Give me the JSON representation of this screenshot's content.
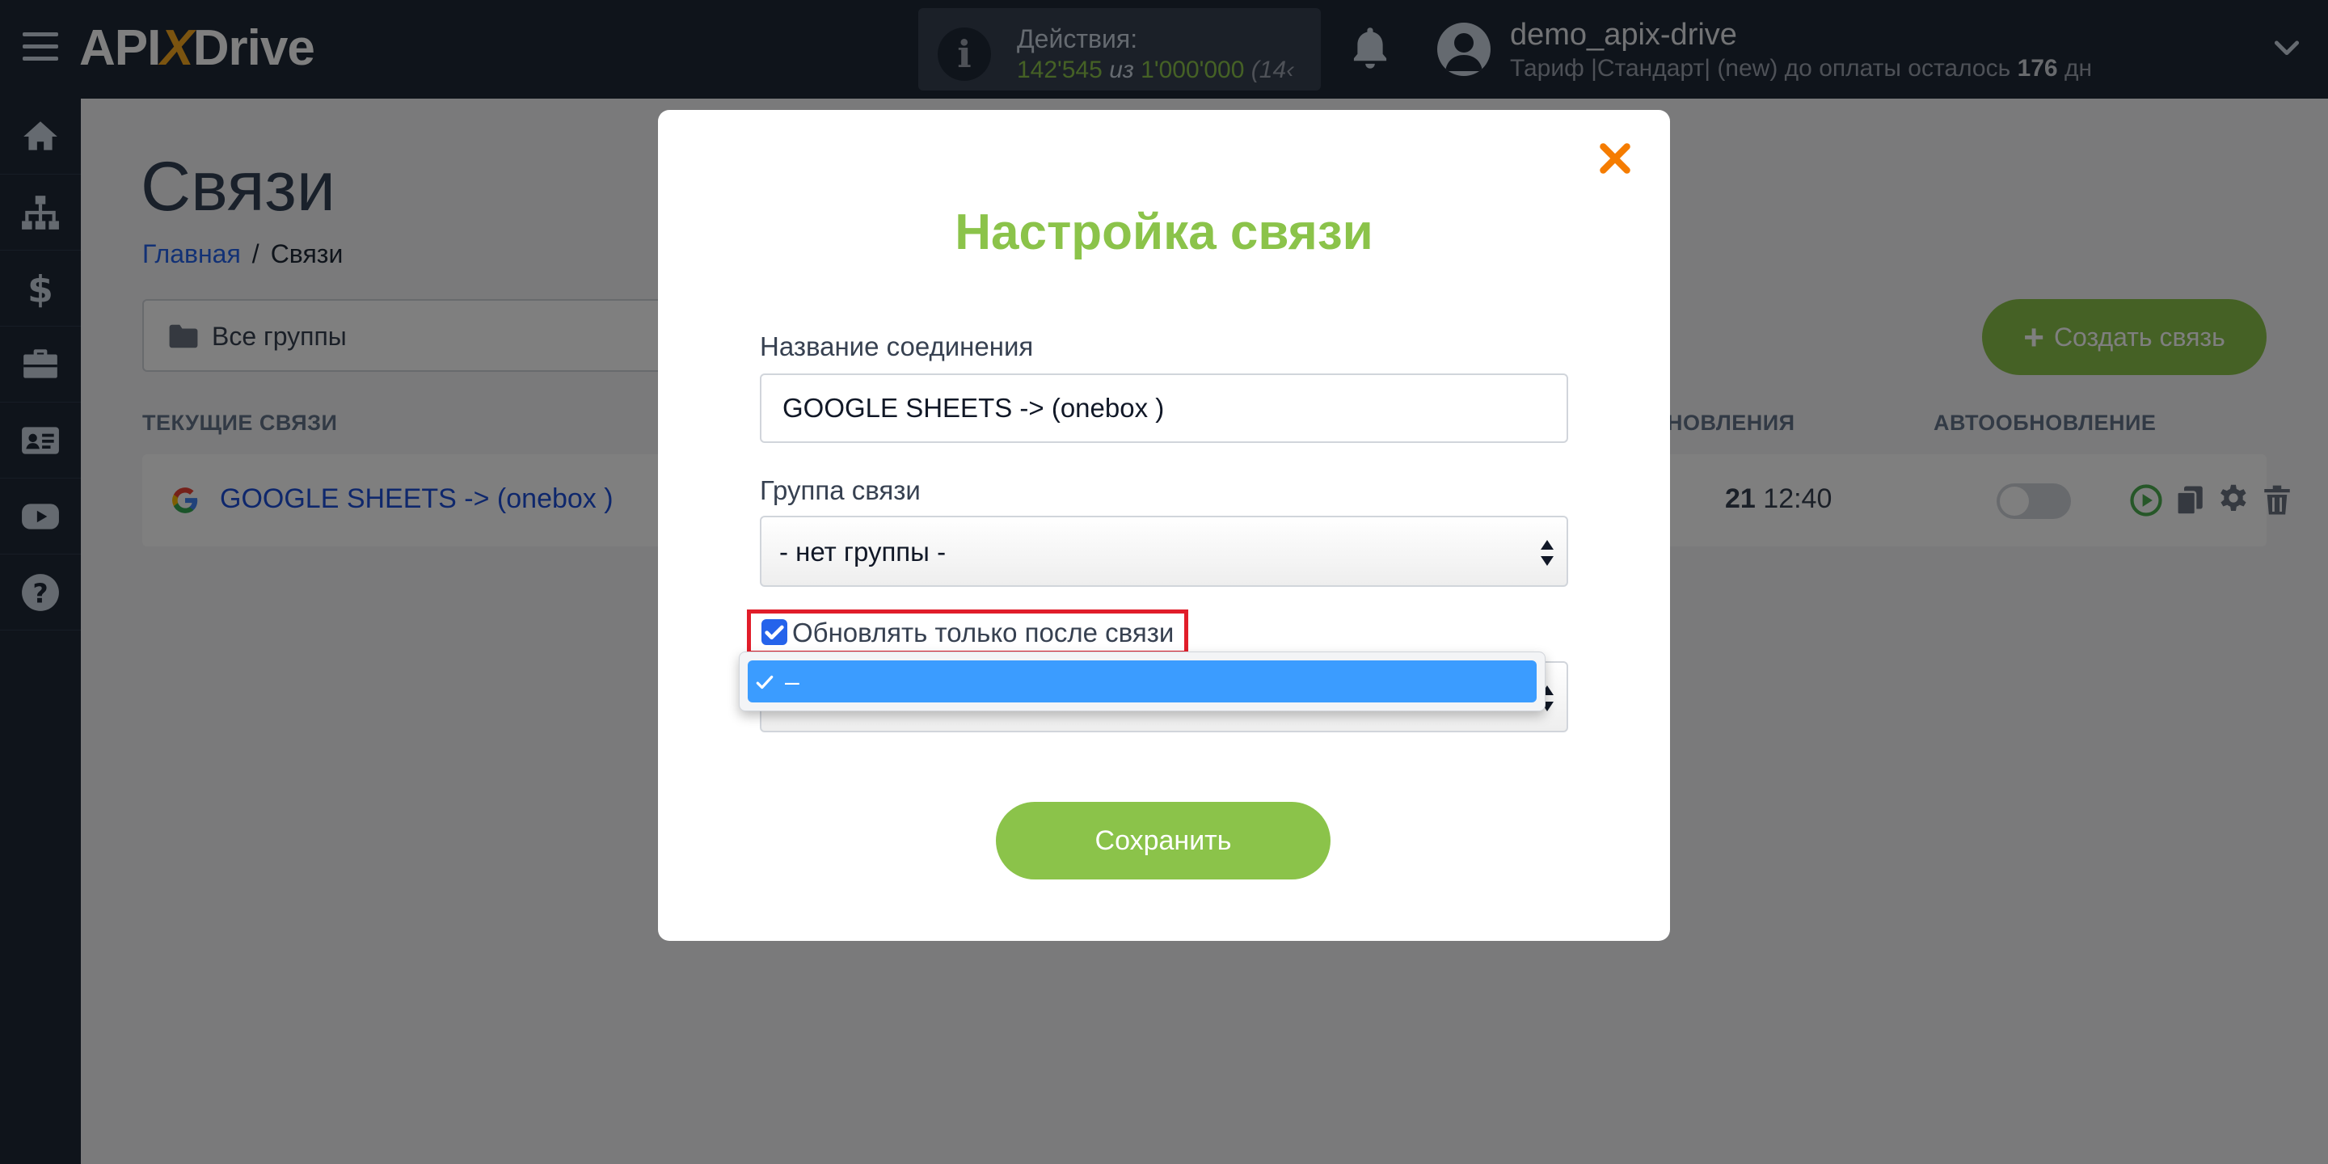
{
  "header": {
    "logo": {
      "api": "API",
      "x": "X",
      "drive": "Drive"
    },
    "actions": {
      "title": "Действия:",
      "used": "142'545",
      "separator": "из",
      "total": "1'000'000",
      "extra": "(14‹"
    },
    "user": {
      "name": "demo_apix-drive",
      "plan_prefix": "Тариф |Стандарт| (new) до оплаты осталось ",
      "days": "176",
      "days_unit": " дн"
    }
  },
  "page": {
    "title": "Связи",
    "breadcrumb": {
      "home": "Главная",
      "separator": "/",
      "current": "Связи"
    },
    "group_filter": "Все группы",
    "create_button": "Создать связь",
    "create_button_icon": "+",
    "columns": {
      "current": "ТЕКУЩИЕ СВЯЗИ",
      "updated": "НОВЛЕНИЯ",
      "autoupdate": "АВТООБНОВЛЕНИЕ"
    },
    "rows": [
      {
        "name": "GOOGLE SHEETS -> (onebox )",
        "date_partial": "21",
        "time": "12:40",
        "autoupdate": false
      }
    ]
  },
  "modal": {
    "title": "Настройка связи",
    "name_label": "Название соединения",
    "name_value": "GOOGLE SHEETS -> (onebox )",
    "group_label": "Группа связи",
    "group_value": "- нет группы -",
    "checkbox_label": "Обновлять только после связи",
    "checkbox_checked": true,
    "dropdown_selected": "–",
    "save_button": "Сохранить",
    "close_icon": "×"
  },
  "icons": {
    "sidebar": [
      "home-icon",
      "sitemap-icon",
      "dollar-icon",
      "briefcase-icon",
      "id-card-icon",
      "youtube-icon",
      "help-icon"
    ],
    "row": [
      "play-icon",
      "copy-icon",
      "gear-icon",
      "trash-icon"
    ]
  },
  "colors": {
    "accent_green": "#8bc34a",
    "close_orange": "#f57c00",
    "highlight_red": "#e11d2a",
    "topbar": "#1f2937",
    "selected_option": "#3b9cff"
  }
}
